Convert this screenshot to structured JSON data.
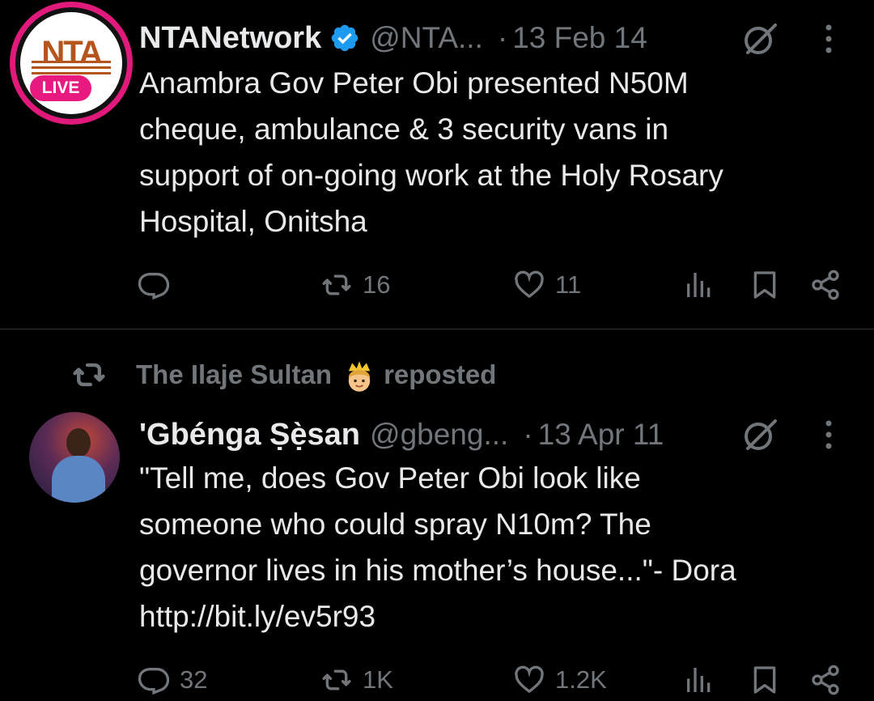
{
  "tweets": [
    {
      "author": {
        "display_name": "NTANetwork",
        "handle": "@NTA...",
        "verified": true,
        "avatar_badge": "LIVE",
        "avatar_letters": "NTA"
      },
      "dot": "·",
      "date": "13 Feb 14",
      "text": "Anambra Gov Peter Obi presented N50M\ncheque, ambulance & 3 security vans in\nsupport of on-going work at the Holy  Rosary\nHospital, Onitsha",
      "actions": {
        "replies": "",
        "retweets": "16",
        "likes": "11"
      }
    },
    {
      "reposted_by": {
        "name": "The Ilaje Sultan",
        "emoji": "prince-emoji",
        "label": "reposted"
      },
      "author": {
        "display_name": "'Gbénga Ṣẹ̀san",
        "handle": "@gbeng...",
        "verified": false
      },
      "dot": "·",
      "date": "13 Apr 11",
      "text": "\"Tell me, does Gov Peter Obi look like\nsomeone who could spray N10m? The\ngovernor lives in his mother’s house...\"- Dora\nhttp://bit.ly/ev5r93",
      "actions": {
        "replies": "32",
        "retweets": "1K",
        "likes": "1.2K"
      }
    }
  ],
  "colors": {
    "background": "#000000",
    "text": "#e7e9ea",
    "muted": "#71767b",
    "verified": "#1d9bf0",
    "live_badge": "#e8197f",
    "divider": "#2f3336"
  },
  "icons": {
    "reply": "reply-icon",
    "retweet": "retweet-icon",
    "like": "heart-icon",
    "views": "views-icon",
    "bookmark": "bookmark-icon",
    "share": "share-icon",
    "grok": "grok-icon",
    "more": "more-icon"
  }
}
